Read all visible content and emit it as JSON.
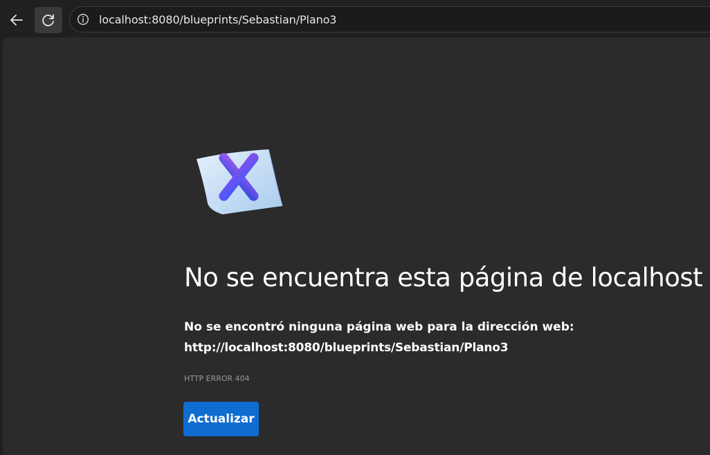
{
  "browser": {
    "address_bar": {
      "url": "localhost:8080/blueprints/Sebastian/Plano3"
    },
    "icons": {
      "back": "arrow-left-icon",
      "reload": "reload-icon",
      "site_info": "info-icon"
    }
  },
  "error_page": {
    "illustration": "error-document-x-icon",
    "title": "No se encuentra esta página de localhost",
    "description_line1": "No se encontró ninguna página web para la dirección web:",
    "description_url": "http://localhost:8080/blueprints/Sebastian/Plano3",
    "error_code": "HTTP ERROR 404",
    "reload_button_label": "Actualizar"
  },
  "colors": {
    "page_background": "#2b2b2b",
    "toolbar_background": "#202020",
    "button_accent": "#0f6cd0",
    "x_gradient_start": "#8a4de8",
    "x_gradient_end": "#3f5bff"
  }
}
